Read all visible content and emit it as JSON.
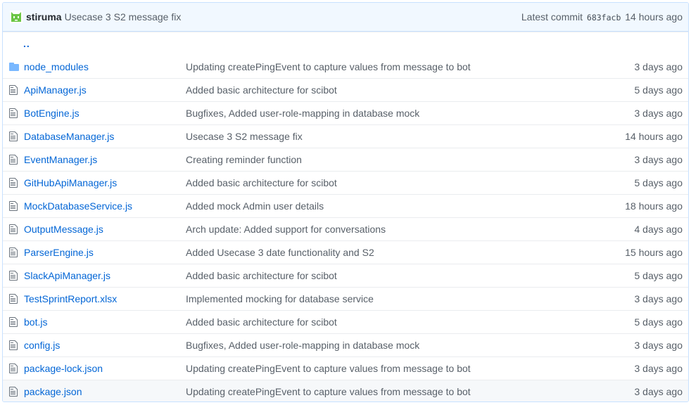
{
  "colors": {
    "link": "#0366d6",
    "muted": "#586069",
    "folder": "#79b8ff",
    "header_bg": "#f1f8ff",
    "border": "#c8e1ff",
    "avatar": "#6cc644"
  },
  "latest_commit": {
    "author": "stiruma",
    "message": "Usecase 3 S2 message fix",
    "label": "Latest commit",
    "sha": "683facb",
    "age": "14 hours ago"
  },
  "parent_dir": "..",
  "files": [
    {
      "icon": "folder-icon",
      "name": "node_modules",
      "message": "Updating createPingEvent to capture values from message to bot",
      "age": "3 days ago"
    },
    {
      "icon": "file-icon",
      "name": "ApiManager.js",
      "message": "Added basic architecture for scibot",
      "age": "5 days ago"
    },
    {
      "icon": "file-icon",
      "name": "BotEngine.js",
      "message": "Bugfixes, Added user-role-mapping in database mock",
      "age": "3 days ago"
    },
    {
      "icon": "file-icon",
      "name": "DatabaseManager.js",
      "message": "Usecase 3 S2 message fix",
      "age": "14 hours ago"
    },
    {
      "icon": "file-icon",
      "name": "EventManager.js",
      "message": "Creating reminder function",
      "age": "3 days ago"
    },
    {
      "icon": "file-icon",
      "name": "GitHubApiManager.js",
      "message": "Added basic architecture for scibot",
      "age": "5 days ago"
    },
    {
      "icon": "file-icon",
      "name": "MockDatabaseService.js",
      "message": "Added mock Admin user details",
      "age": "18 hours ago"
    },
    {
      "icon": "file-icon",
      "name": "OutputMessage.js",
      "message": "Arch update: Added support for conversations",
      "age": "4 days ago"
    },
    {
      "icon": "file-icon",
      "name": "ParserEngine.js",
      "message": "Added Usecase 3 date functionality and S2",
      "age": "15 hours ago"
    },
    {
      "icon": "file-icon",
      "name": "SlackApiManager.js",
      "message": "Added basic architecture for scibot",
      "age": "5 days ago"
    },
    {
      "icon": "file-icon",
      "name": "TestSprintReport.xlsx",
      "message": "Implemented mocking for database service",
      "age": "3 days ago"
    },
    {
      "icon": "file-icon",
      "name": "bot.js",
      "message": "Added basic architecture for scibot",
      "age": "5 days ago"
    },
    {
      "icon": "file-icon",
      "name": "config.js",
      "message": "Bugfixes, Added user-role-mapping in database mock",
      "age": "3 days ago"
    },
    {
      "icon": "file-icon",
      "name": "package-lock.json",
      "message": "Updating createPingEvent to capture values from message to bot",
      "age": "3 days ago"
    },
    {
      "icon": "file-icon",
      "name": "package.json",
      "message": "Updating createPingEvent to capture values from message to bot",
      "age": "3 days ago"
    }
  ]
}
